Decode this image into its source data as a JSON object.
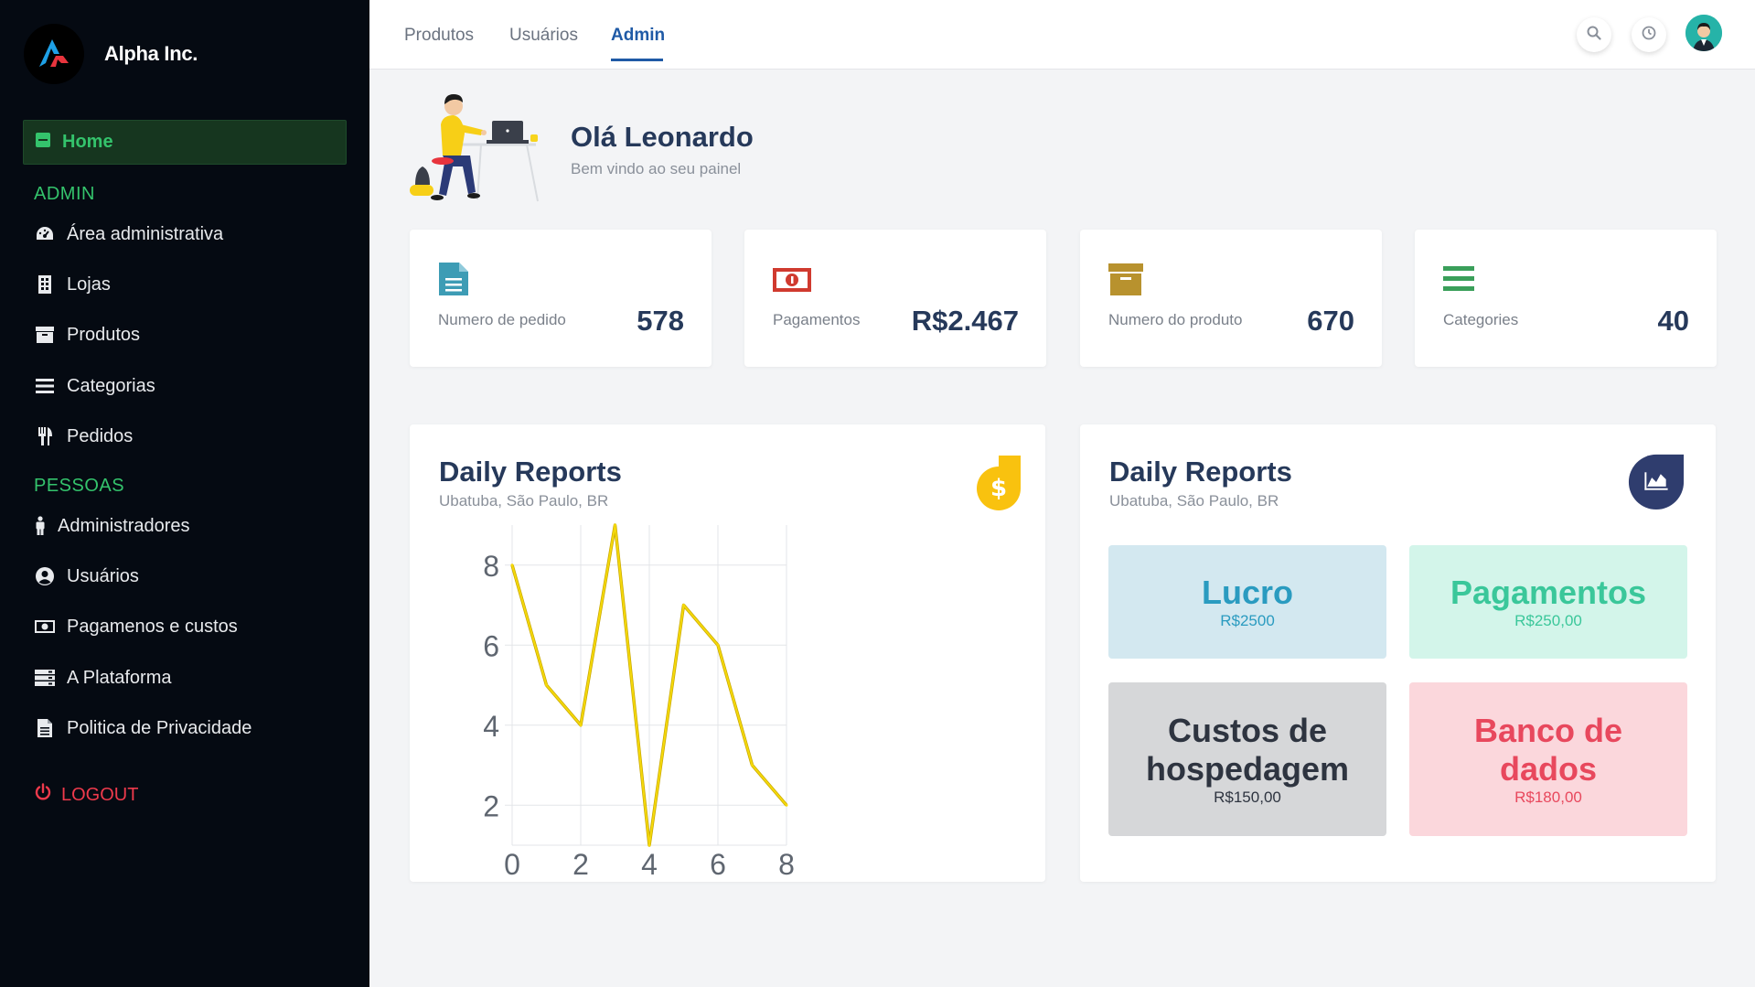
{
  "brand": {
    "name": "Alpha Inc."
  },
  "sidebar": {
    "home_label": "Home",
    "section_admin": "ADMIN",
    "admin_items": [
      {
        "label": "Área administrativa",
        "icon": "dashboard-icon"
      },
      {
        "label": "Lojas",
        "icon": "building-icon"
      },
      {
        "label": "Produtos",
        "icon": "archive-box-icon"
      },
      {
        "label": "Categorias",
        "icon": "list-icon"
      },
      {
        "label": "Pedidos",
        "icon": "utensils-icon"
      }
    ],
    "section_people": "PESSOAS",
    "people_items": [
      {
        "label": "Administradores",
        "icon": "person-icon"
      },
      {
        "label": "Usuários",
        "icon": "user-circle-icon"
      },
      {
        "label": "Pagamenos e custos",
        "icon": "money-bill-icon"
      },
      {
        "label": "A Plataforma",
        "icon": "server-icon"
      },
      {
        "label": "Politica de Privacidade",
        "icon": "file-icon"
      }
    ],
    "logout_label": "LOGOUT"
  },
  "topbar": {
    "tabs": [
      "Produtos",
      "Usuários",
      "Admin"
    ],
    "active_tab": "Admin"
  },
  "greeting": {
    "title": "Olá Leonardo",
    "subtitle": "Bem vindo ao seu painel"
  },
  "stats": [
    {
      "label": "Numero de pedido",
      "value": "578",
      "icon": "document-icon",
      "color": "#3d9cb5"
    },
    {
      "label": "Pagamentos",
      "value": "R$2.467",
      "icon": "money-bill-icon",
      "color": "#d03a2f"
    },
    {
      "label": "Numero do produto",
      "value": "670",
      "icon": "archive-box-icon",
      "color": "#b8922e"
    },
    {
      "label": "Categories",
      "value": "40",
      "icon": "list-icon",
      "color": "#3a9f5a"
    }
  ],
  "reports": [
    {
      "title": "Daily Reports",
      "subtitle": "Ubatuba, São Paulo, BR",
      "badge_icon": "dollar-icon",
      "badge_color": "#f9c20f"
    },
    {
      "title": "Daily Reports",
      "subtitle": "Ubatuba, São Paulo, BR",
      "badge_icon": "area-chart-icon",
      "badge_color": "#2f3d6e"
    }
  ],
  "chart_data": {
    "type": "line",
    "x": [
      0,
      1,
      2,
      3,
      4,
      5,
      6,
      7,
      8
    ],
    "series": [
      {
        "values": [
          8,
          5,
          4,
          9,
          1,
          7,
          6,
          3,
          2
        ],
        "color": "#f5d90a"
      }
    ],
    "x_ticks": [
      "0",
      "2",
      "4",
      "6",
      "8"
    ],
    "y_ticks": [
      "2",
      "4",
      "6",
      "8"
    ],
    "xlim": [
      0,
      8
    ],
    "ylim": [
      1,
      9
    ],
    "grid": true
  },
  "tiles": [
    {
      "title": "Lucro",
      "value": "R$2500",
      "bg": "#d3e8f0",
      "color": "#2a9bc0"
    },
    {
      "title": "Pagamentos",
      "value": "R$250,00",
      "bg": "#d3f5ea",
      "color": "#3ac79a"
    },
    {
      "title": "Custos de hospedagem",
      "value": "R$150,00",
      "bg": "#d6d7d9",
      "color": "#2e3440"
    },
    {
      "title": "Banco de dados",
      "value": "R$180,00",
      "bg": "#fbd7dc",
      "color": "#e8485d"
    }
  ]
}
